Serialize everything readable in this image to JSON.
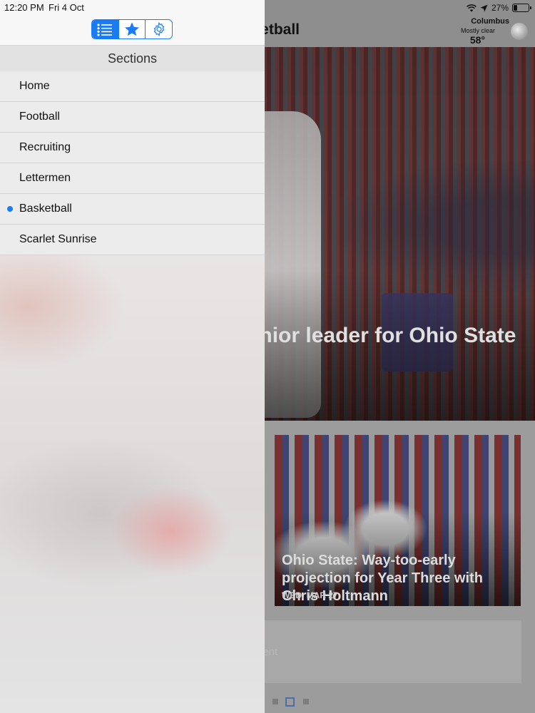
{
  "status_bar": {
    "time": "12:20 PM",
    "date": "Fri 4 Oct",
    "battery_text": "27%",
    "battery_level": 0.27,
    "icons": [
      "wifi-icon",
      "location-arrow-icon",
      "battery-icon"
    ]
  },
  "side_panel": {
    "segmented_control": {
      "items": [
        {
          "icon": "list-icon",
          "active": true
        },
        {
          "icon": "star-icon",
          "active": false
        },
        {
          "icon": "gear-icon",
          "active": false
        }
      ],
      "accent": "#1a7cf5"
    },
    "header": "Sections",
    "items": [
      {
        "label": "Home",
        "selected": false
      },
      {
        "label": "Football",
        "selected": false
      },
      {
        "label": "Recruiting",
        "selected": false
      },
      {
        "label": "Lettermen",
        "selected": false
      },
      {
        "label": "Basketball",
        "selected": true
      },
      {
        "label": "Scarlet Sunrise",
        "selected": false
      }
    ]
  },
  "background_app": {
    "header_title": "etball",
    "weather": {
      "city": "Columbus",
      "condition": "Mostly clear",
      "temperature": "58°"
    },
    "hero_headline": "senior leader for Ohio State",
    "card": {
      "title": "Ohio State: Way-too-early projection for Year Three with Chris Holtmann",
      "date": "WED, MAR 27"
    },
    "ad_label": "sement",
    "page_dots": {
      "count": 3,
      "active_index": 1
    }
  }
}
